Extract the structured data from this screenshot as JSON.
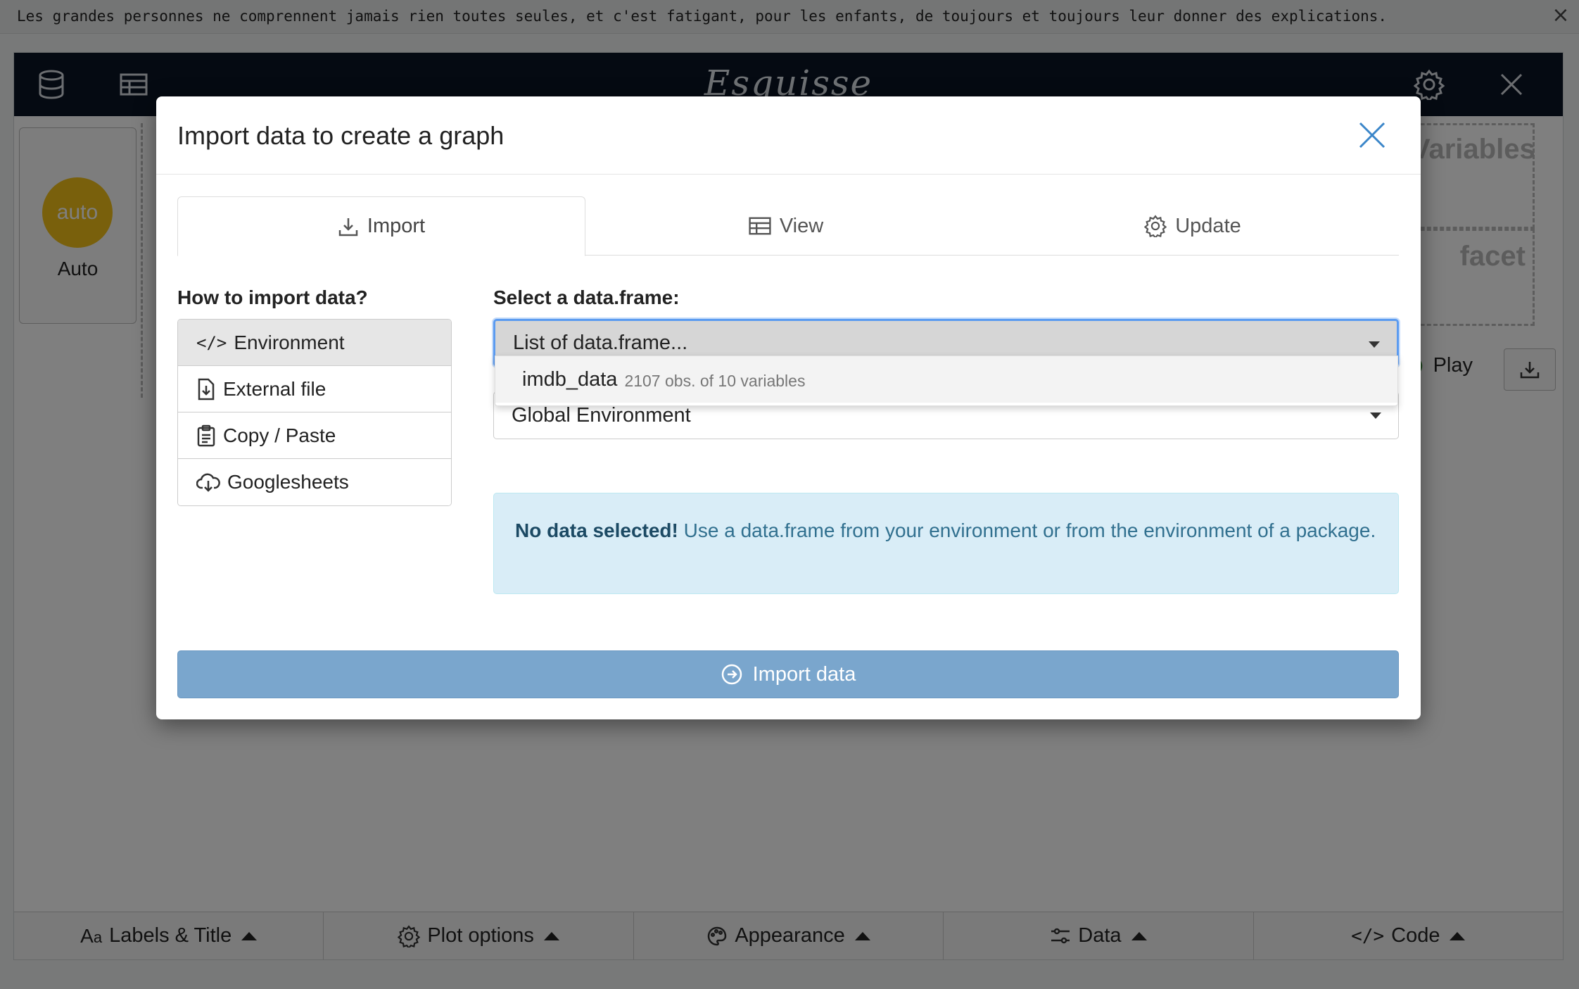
{
  "banner": {
    "text": "Les grandes personnes ne comprennent jamais rien toutes seules, et c'est fatigant, pour les enfants, de toujours et toujours leur donner des explications.",
    "close_glyph": "×"
  },
  "app": {
    "title": "Esquisse",
    "nav_icons": [
      "database-icon",
      "table-icon",
      "gear-icon",
      "close-icon"
    ],
    "geom": {
      "badge": "auto",
      "label": "Auto"
    },
    "dropzones": {
      "variables": "Variables",
      "facet": "facet"
    },
    "play_label": "Play",
    "bottom_bar": [
      {
        "icon": "text-icon",
        "label": "Labels & Title"
      },
      {
        "icon": "gear-icon",
        "label": "Plot options"
      },
      {
        "icon": "palette-icon",
        "label": "Appearance"
      },
      {
        "icon": "sliders-icon",
        "label": "Data"
      },
      {
        "icon": "code-icon",
        "label": "Code"
      }
    ]
  },
  "modal": {
    "title": "Import data to create a graph",
    "tabs": [
      {
        "label": "Import",
        "icon": "download-icon",
        "active": true
      },
      {
        "label": "View",
        "icon": "table-icon",
        "active": false
      },
      {
        "label": "Update",
        "icon": "gear-icon",
        "active": false
      }
    ],
    "how_label": "How to import data?",
    "methods": [
      {
        "label": "Environment",
        "icon": "code-icon",
        "active": true
      },
      {
        "label": "External file",
        "icon": "file-import-icon",
        "active": false
      },
      {
        "label": "Copy / Paste",
        "icon": "clipboard-icon",
        "active": false
      },
      {
        "label": "Googlesheets",
        "icon": "cloud-download-icon",
        "active": false
      }
    ],
    "select_label": "Select a data.frame:",
    "dataframe_select": {
      "value": "List of data.frame..."
    },
    "dropdown_option": {
      "name": "imdb_data",
      "detail": "2107 obs. of 10 variables"
    },
    "env_select": {
      "value": "Global Environment"
    },
    "alert": {
      "strong": "No data selected!",
      "text": " Use a data.frame from your environment or from the environment of a package."
    },
    "import_button": "Import data"
  }
}
